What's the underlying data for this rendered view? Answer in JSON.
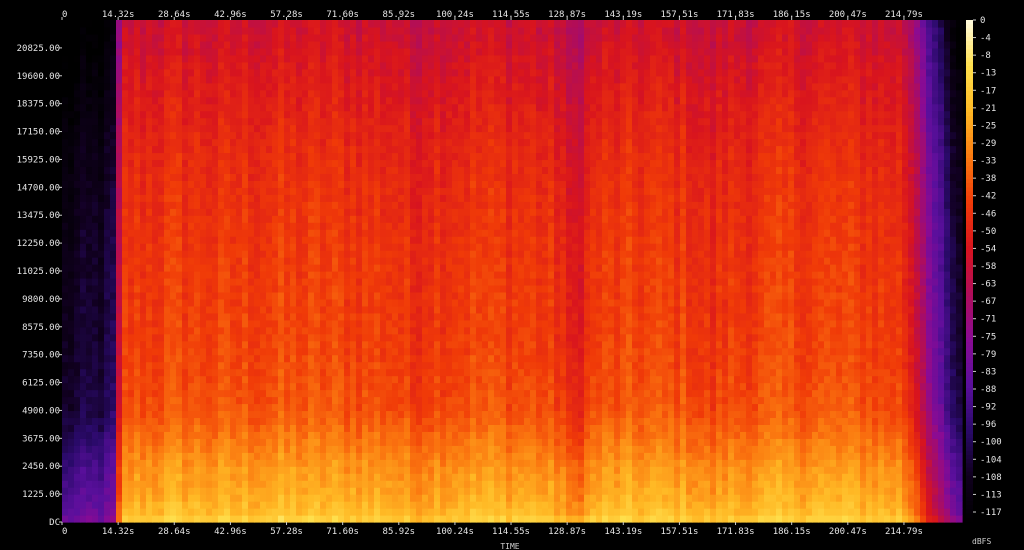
{
  "chart_data": {
    "type": "heatmap",
    "title": "",
    "xlabel": "TIME",
    "ylabel": "",
    "x_ticks": [
      "0",
      "14.32s",
      "28.64s",
      "42.96s",
      "57.28s",
      "71.60s",
      "85.92s",
      "100.24s",
      "114.55s",
      "128.87s",
      "143.19s",
      "157.51s",
      "171.83s",
      "186.15s",
      "200.47s",
      "214.79s"
    ],
    "x_tick_values": [
      0,
      14.32,
      28.64,
      42.96,
      57.28,
      71.6,
      85.92,
      100.24,
      114.55,
      128.87,
      143.19,
      157.51,
      171.83,
      186.15,
      200.47,
      214.79
    ],
    "xlim": [
      0,
      229.6
    ],
    "y_ticks": [
      "DC",
      "1225.00",
      "2450.00",
      "3675.00",
      "4900.00",
      "6125.00",
      "7350.00",
      "8575.00",
      "9800.00",
      "11025.00",
      "12250.00",
      "13475.00",
      "14700.00",
      "15925.00",
      "17150.00",
      "18375.00",
      "19600.00",
      "20825.00"
    ],
    "y_tick_values": [
      0,
      1225,
      2450,
      3675,
      4900,
      6125,
      7350,
      8575,
      9800,
      11025,
      12250,
      13475,
      14700,
      15925,
      17150,
      18375,
      19600,
      20825
    ],
    "ylim": [
      0,
      22050
    ],
    "colorbar": {
      "label": "dBFS",
      "ticks": [
        "0",
        "-4",
        "-8",
        "-13",
        "-17",
        "-21",
        "-25",
        "-29",
        "-33",
        "-38",
        "-42",
        "-46",
        "-50",
        "-54",
        "-58",
        "-63",
        "-67",
        "-71",
        "-75",
        "-79",
        "-83",
        "-88",
        "-92",
        "-96",
        "-100",
        "-104",
        "-108",
        "-113",
        "-117"
      ],
      "range": [
        -117,
        0
      ]
    },
    "colormap": [
      "#000000",
      "#10001e",
      "#2a0a6a",
      "#5a0f9c",
      "#8a0b94",
      "#b00d5a",
      "#d8141e",
      "#f03a08",
      "#fb7a10",
      "#ffb824",
      "#ffe04d",
      "#fffbe0"
    ],
    "spectrum": {
      "time_profile": [
        [
          0,
          -110
        ],
        [
          2,
          -108
        ],
        [
          12,
          -104
        ],
        [
          14,
          -98
        ],
        [
          14.8,
          -44
        ],
        [
          30,
          -42
        ],
        [
          40,
          -43
        ],
        [
          55,
          -42
        ],
        [
          70,
          -42
        ],
        [
          85,
          -43
        ],
        [
          88,
          -45
        ],
        [
          89,
          -48
        ],
        [
          92,
          -44
        ],
        [
          105,
          -42
        ],
        [
          120,
          -43
        ],
        [
          128,
          -46
        ],
        [
          129,
          -54
        ],
        [
          133,
          -49
        ],
        [
          136,
          -43
        ],
        [
          150,
          -42
        ],
        [
          160,
          -43
        ],
        [
          166,
          -47
        ],
        [
          169,
          -44
        ],
        [
          185,
          -42
        ],
        [
          200,
          -42
        ],
        [
          214,
          -44
        ],
        [
          218,
          -56
        ],
        [
          224,
          -88
        ],
        [
          229.6,
          -110
        ]
      ],
      "freq_profile": [
        [
          0,
          30
        ],
        [
          300,
          24
        ],
        [
          1000,
          20
        ],
        [
          2500,
          15
        ],
        [
          3800,
          9
        ],
        [
          5000,
          4
        ],
        [
          8000,
          1
        ],
        [
          12000,
          -1
        ],
        [
          16000,
          -4
        ],
        [
          20000,
          -10
        ],
        [
          22050,
          -14
        ]
      ]
    }
  }
}
